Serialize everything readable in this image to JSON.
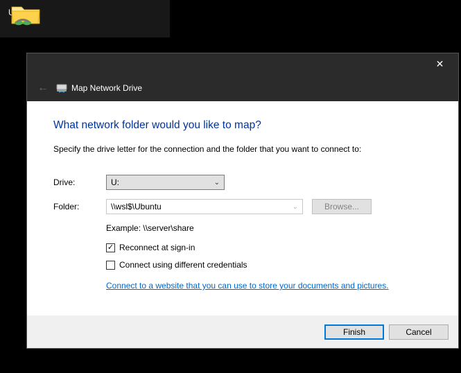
{
  "desktop": {
    "icon_label": "Ubuntu"
  },
  "dialog": {
    "window_title": "Map Network Drive",
    "heading": "What network folder would you like to map?",
    "instruction": "Specify the drive letter for the connection and the folder that you want to connect to:",
    "drive_label": "Drive:",
    "drive_value": "U:",
    "folder_label": "Folder:",
    "folder_value": "\\\\wsl$\\Ubuntu",
    "browse_label": "Browse...",
    "example_label": "Example: \\\\server\\share",
    "reconnect_label": "Reconnect at sign-in",
    "reconnect_checked": true,
    "diffcreds_label": "Connect using different credentials",
    "diffcreds_checked": false,
    "link_text": "Connect to a website that you can use to store your documents and pictures",
    "finish_label": "Finish",
    "cancel_label": "Cancel"
  },
  "icons": {
    "close": "✕",
    "back": "←",
    "chevron": "⌄",
    "check": "✓"
  }
}
